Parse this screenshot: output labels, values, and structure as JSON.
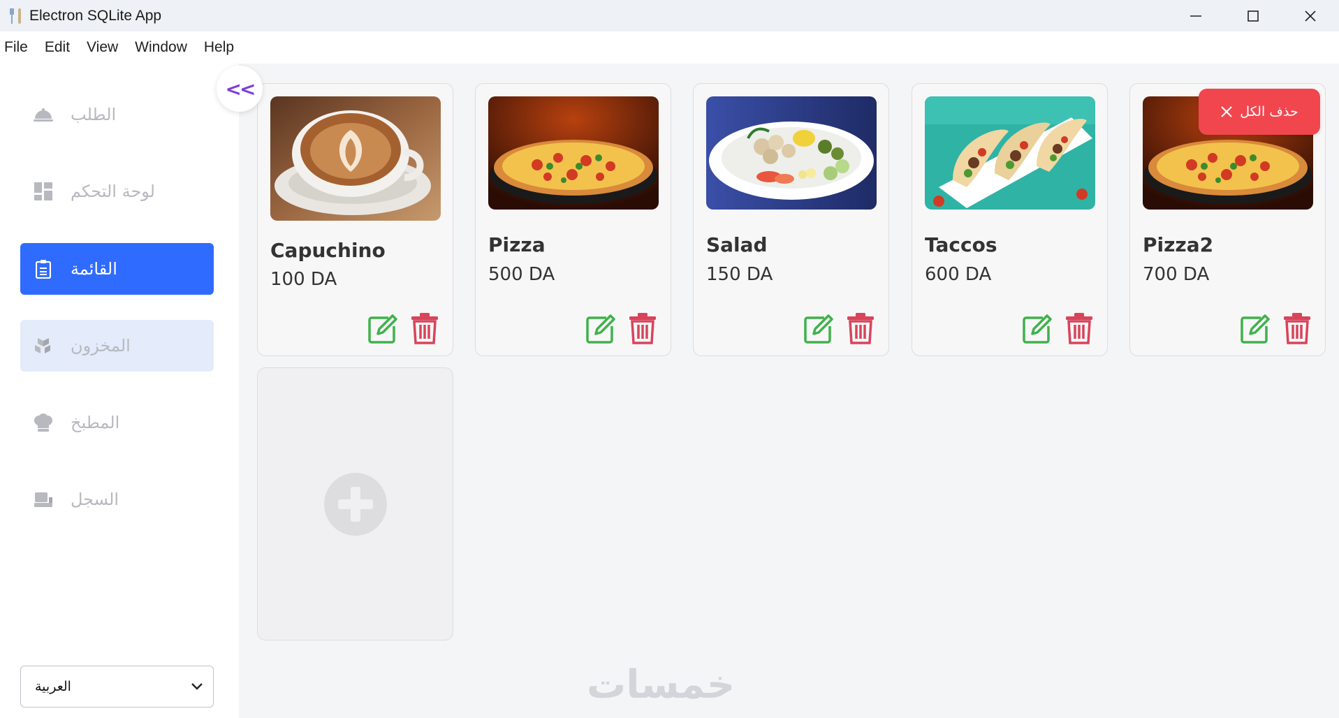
{
  "window": {
    "title": "Electron SQLite App"
  },
  "menu": [
    "File",
    "Edit",
    "View",
    "Window",
    "Help"
  ],
  "sidebar": {
    "collapse_label": "<<",
    "items": [
      {
        "label": "الطلب",
        "icon": "dish-icon",
        "state": "normal"
      },
      {
        "label": "لوحة التحكم",
        "icon": "dashboard-icon",
        "state": "normal"
      },
      {
        "label": "القائمة",
        "icon": "menu-list-icon",
        "state": "active"
      },
      {
        "label": "المخزون",
        "icon": "boxes-icon",
        "state": "hover"
      },
      {
        "label": "المطبخ",
        "icon": "chef-hat-icon",
        "state": "normal"
      },
      {
        "label": "السجل",
        "icon": "register-icon",
        "state": "normal"
      }
    ],
    "language": {
      "selected": "العربية"
    }
  },
  "delete_all": {
    "label": "حذف الكل"
  },
  "products": [
    {
      "name": "Capuchino",
      "price": "100 DA",
      "image": "coffee"
    },
    {
      "name": "Pizza",
      "price": "500 DA",
      "image": "pizza"
    },
    {
      "name": "Salad",
      "price": "150 DA",
      "image": "salad"
    },
    {
      "name": "Taccos",
      "price": "600 DA",
      "image": "tacos"
    },
    {
      "name": "Pizza2",
      "price": "700 DA",
      "image": "pizza"
    }
  ],
  "watermark": "خمسات",
  "colors": {
    "active_nav": "#2f6bff",
    "hover_nav": "#e4ebfb",
    "edit_icon": "#3fb24a",
    "delete_icon": "#d9445a",
    "delete_all": "#f2464f",
    "collapse_arrow": "#7a3fd8"
  }
}
